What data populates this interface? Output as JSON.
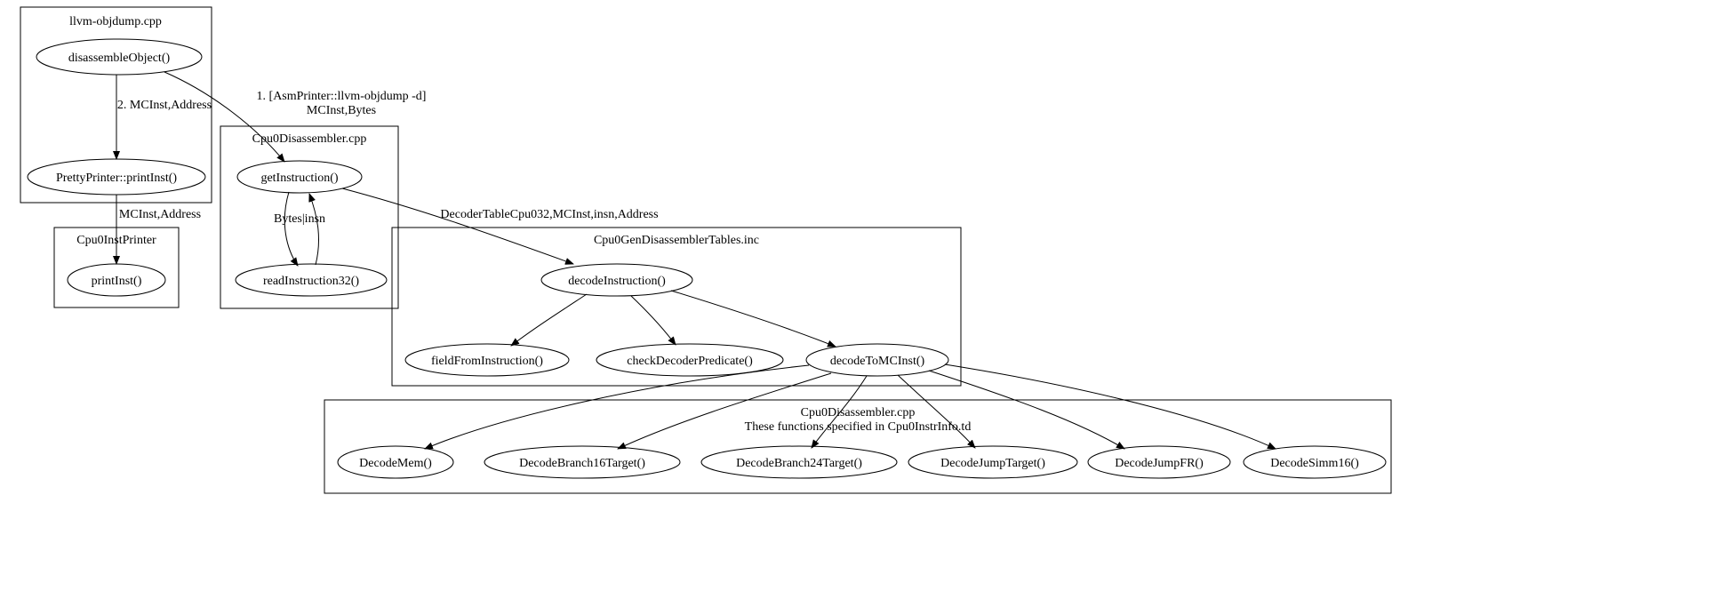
{
  "clusters": {
    "objdump": {
      "label": "llvm-objdump.cpp"
    },
    "disasm": {
      "label": "Cpu0Disassembler.cpp"
    },
    "instprinter": {
      "label": "Cpu0InstPrinter"
    },
    "gentables": {
      "label": "Cpu0GenDisassemblerTables.inc"
    },
    "decodefuncs_l1": {
      "label": "Cpu0Disassembler.cpp"
    },
    "decodefuncs_l2": {
      "label": "These functions specified in Cpu0InstrInfo.td"
    }
  },
  "nodes": {
    "disassembleObject": {
      "label": "disassembleObject()"
    },
    "prettyPrint": {
      "label": "PrettyPrinter::printInst()"
    },
    "printInst": {
      "label": "printInst()"
    },
    "getInstruction": {
      "label": "getInstruction()"
    },
    "readInstruction32": {
      "label": "readInstruction32()"
    },
    "decodeInstruction": {
      "label": "decodeInstruction()"
    },
    "fieldFromInstruction": {
      "label": "fieldFromInstruction()"
    },
    "checkDecoderPredicate": {
      "label": "checkDecoderPredicate()"
    },
    "decodeToMCInst": {
      "label": "decodeToMCInst()"
    },
    "DecodeMem": {
      "label": "DecodeMem()"
    },
    "DecodeBranch16Target": {
      "label": "DecodeBranch16Target()"
    },
    "DecodeBranch24Target": {
      "label": "DecodeBranch24Target()"
    },
    "DecodeJumpTarget": {
      "label": "DecodeJumpTarget()"
    },
    "DecodeJumpFR": {
      "label": "DecodeJumpFR()"
    },
    "DecodeSimm16": {
      "label": "DecodeSimm16()"
    }
  },
  "edges": {
    "e1_l1": {
      "label": "1. [AsmPrinter::llvm-objdump -d]"
    },
    "e1_l2": {
      "label": "MCInst,Bytes"
    },
    "e2": {
      "label": "2. MCInst,Address"
    },
    "e3": {
      "label": "MCInst,Address"
    },
    "e4": {
      "label": "Bytes|insn"
    },
    "e5": {
      "label": "DecoderTableCpu032,MCInst,insn,Address"
    }
  }
}
